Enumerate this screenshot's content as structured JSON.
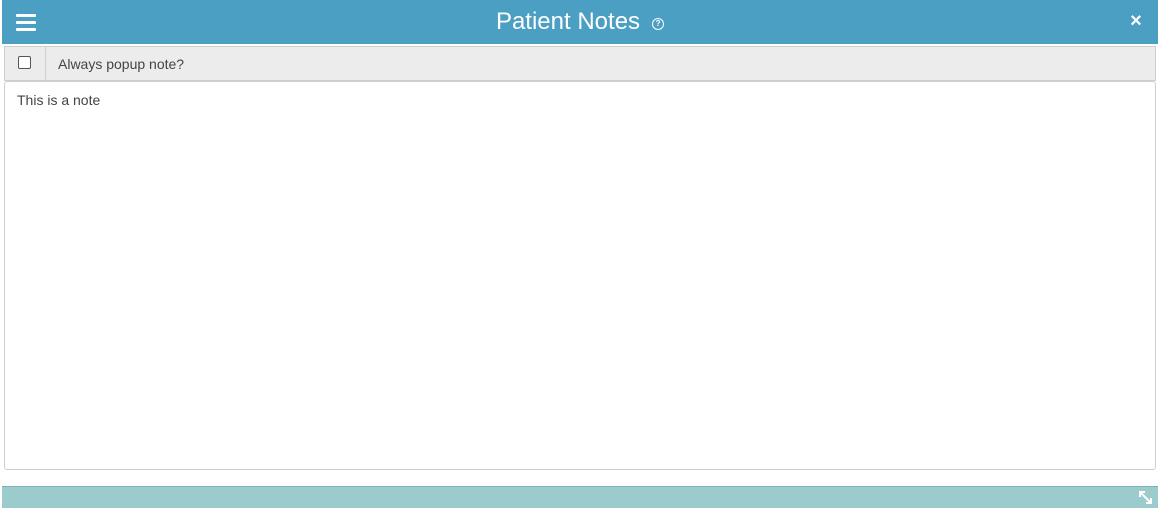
{
  "window": {
    "title": "Patient Notes",
    "menu_icon": "hamburger-menu-icon",
    "help_icon": "question-circle-icon",
    "help_glyph": "?",
    "close_icon": "close-icon",
    "close_glyph": "×",
    "titlebar_color": "#4a9fc2"
  },
  "options": {
    "always_popup_label": "Always popup note?",
    "always_popup_checked": false
  },
  "note": {
    "text": "This is a note"
  },
  "footer": {
    "resize_icon": "resize-diagonal-icon",
    "color": "#9bcbcd"
  }
}
